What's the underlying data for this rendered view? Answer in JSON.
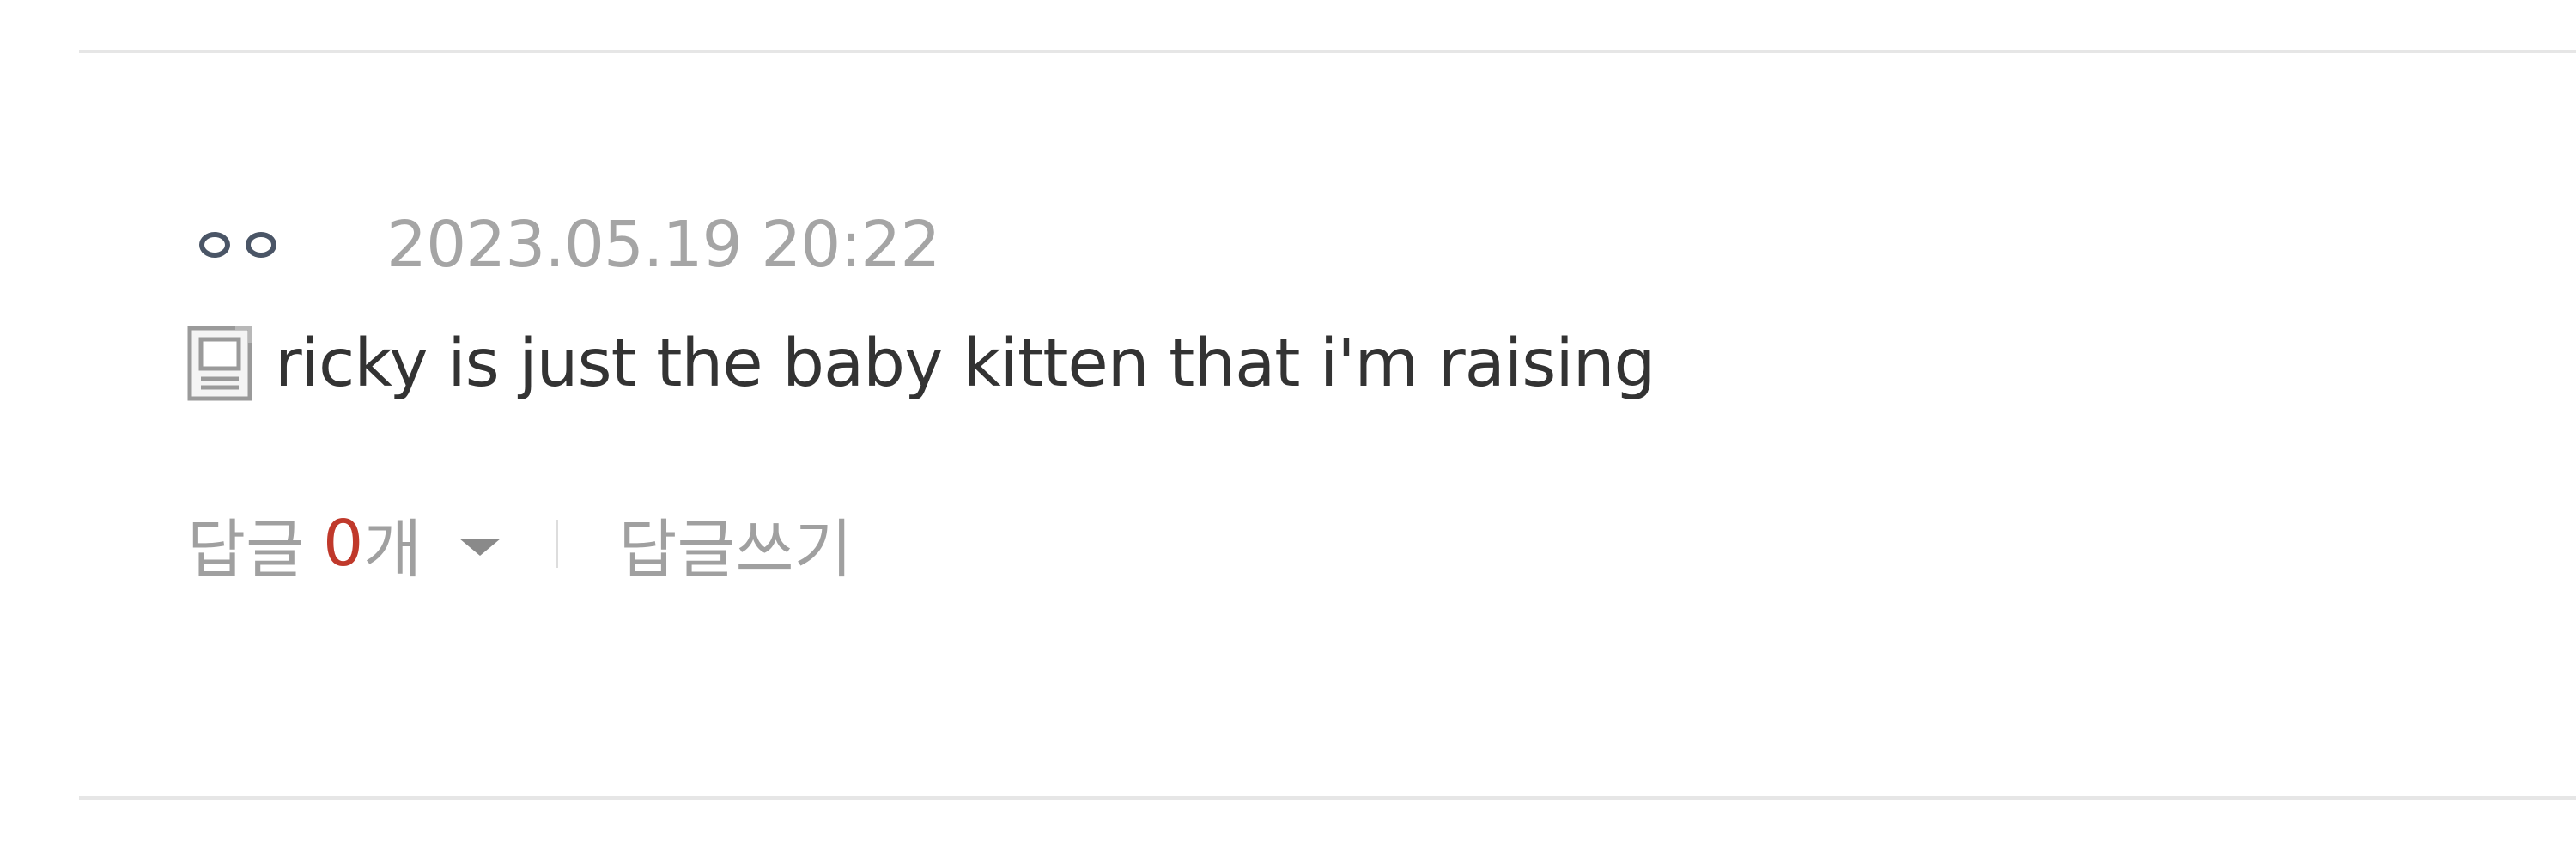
{
  "comment": {
    "author_icon": "two-circle-avatar-icon",
    "timestamp": "2023.05.19 20:22",
    "body_icon": "document-icon",
    "text": "ricky is just the baby kitten that i'm raising",
    "reply_label": "답글",
    "reply_count": "0",
    "reply_unit": "개",
    "write_reply_label": "답글쓰기"
  },
  "colors": {
    "text": "#333333",
    "muted": "#a5a5a5",
    "accent": "#c0392b",
    "divider": "#e6e6e6"
  }
}
